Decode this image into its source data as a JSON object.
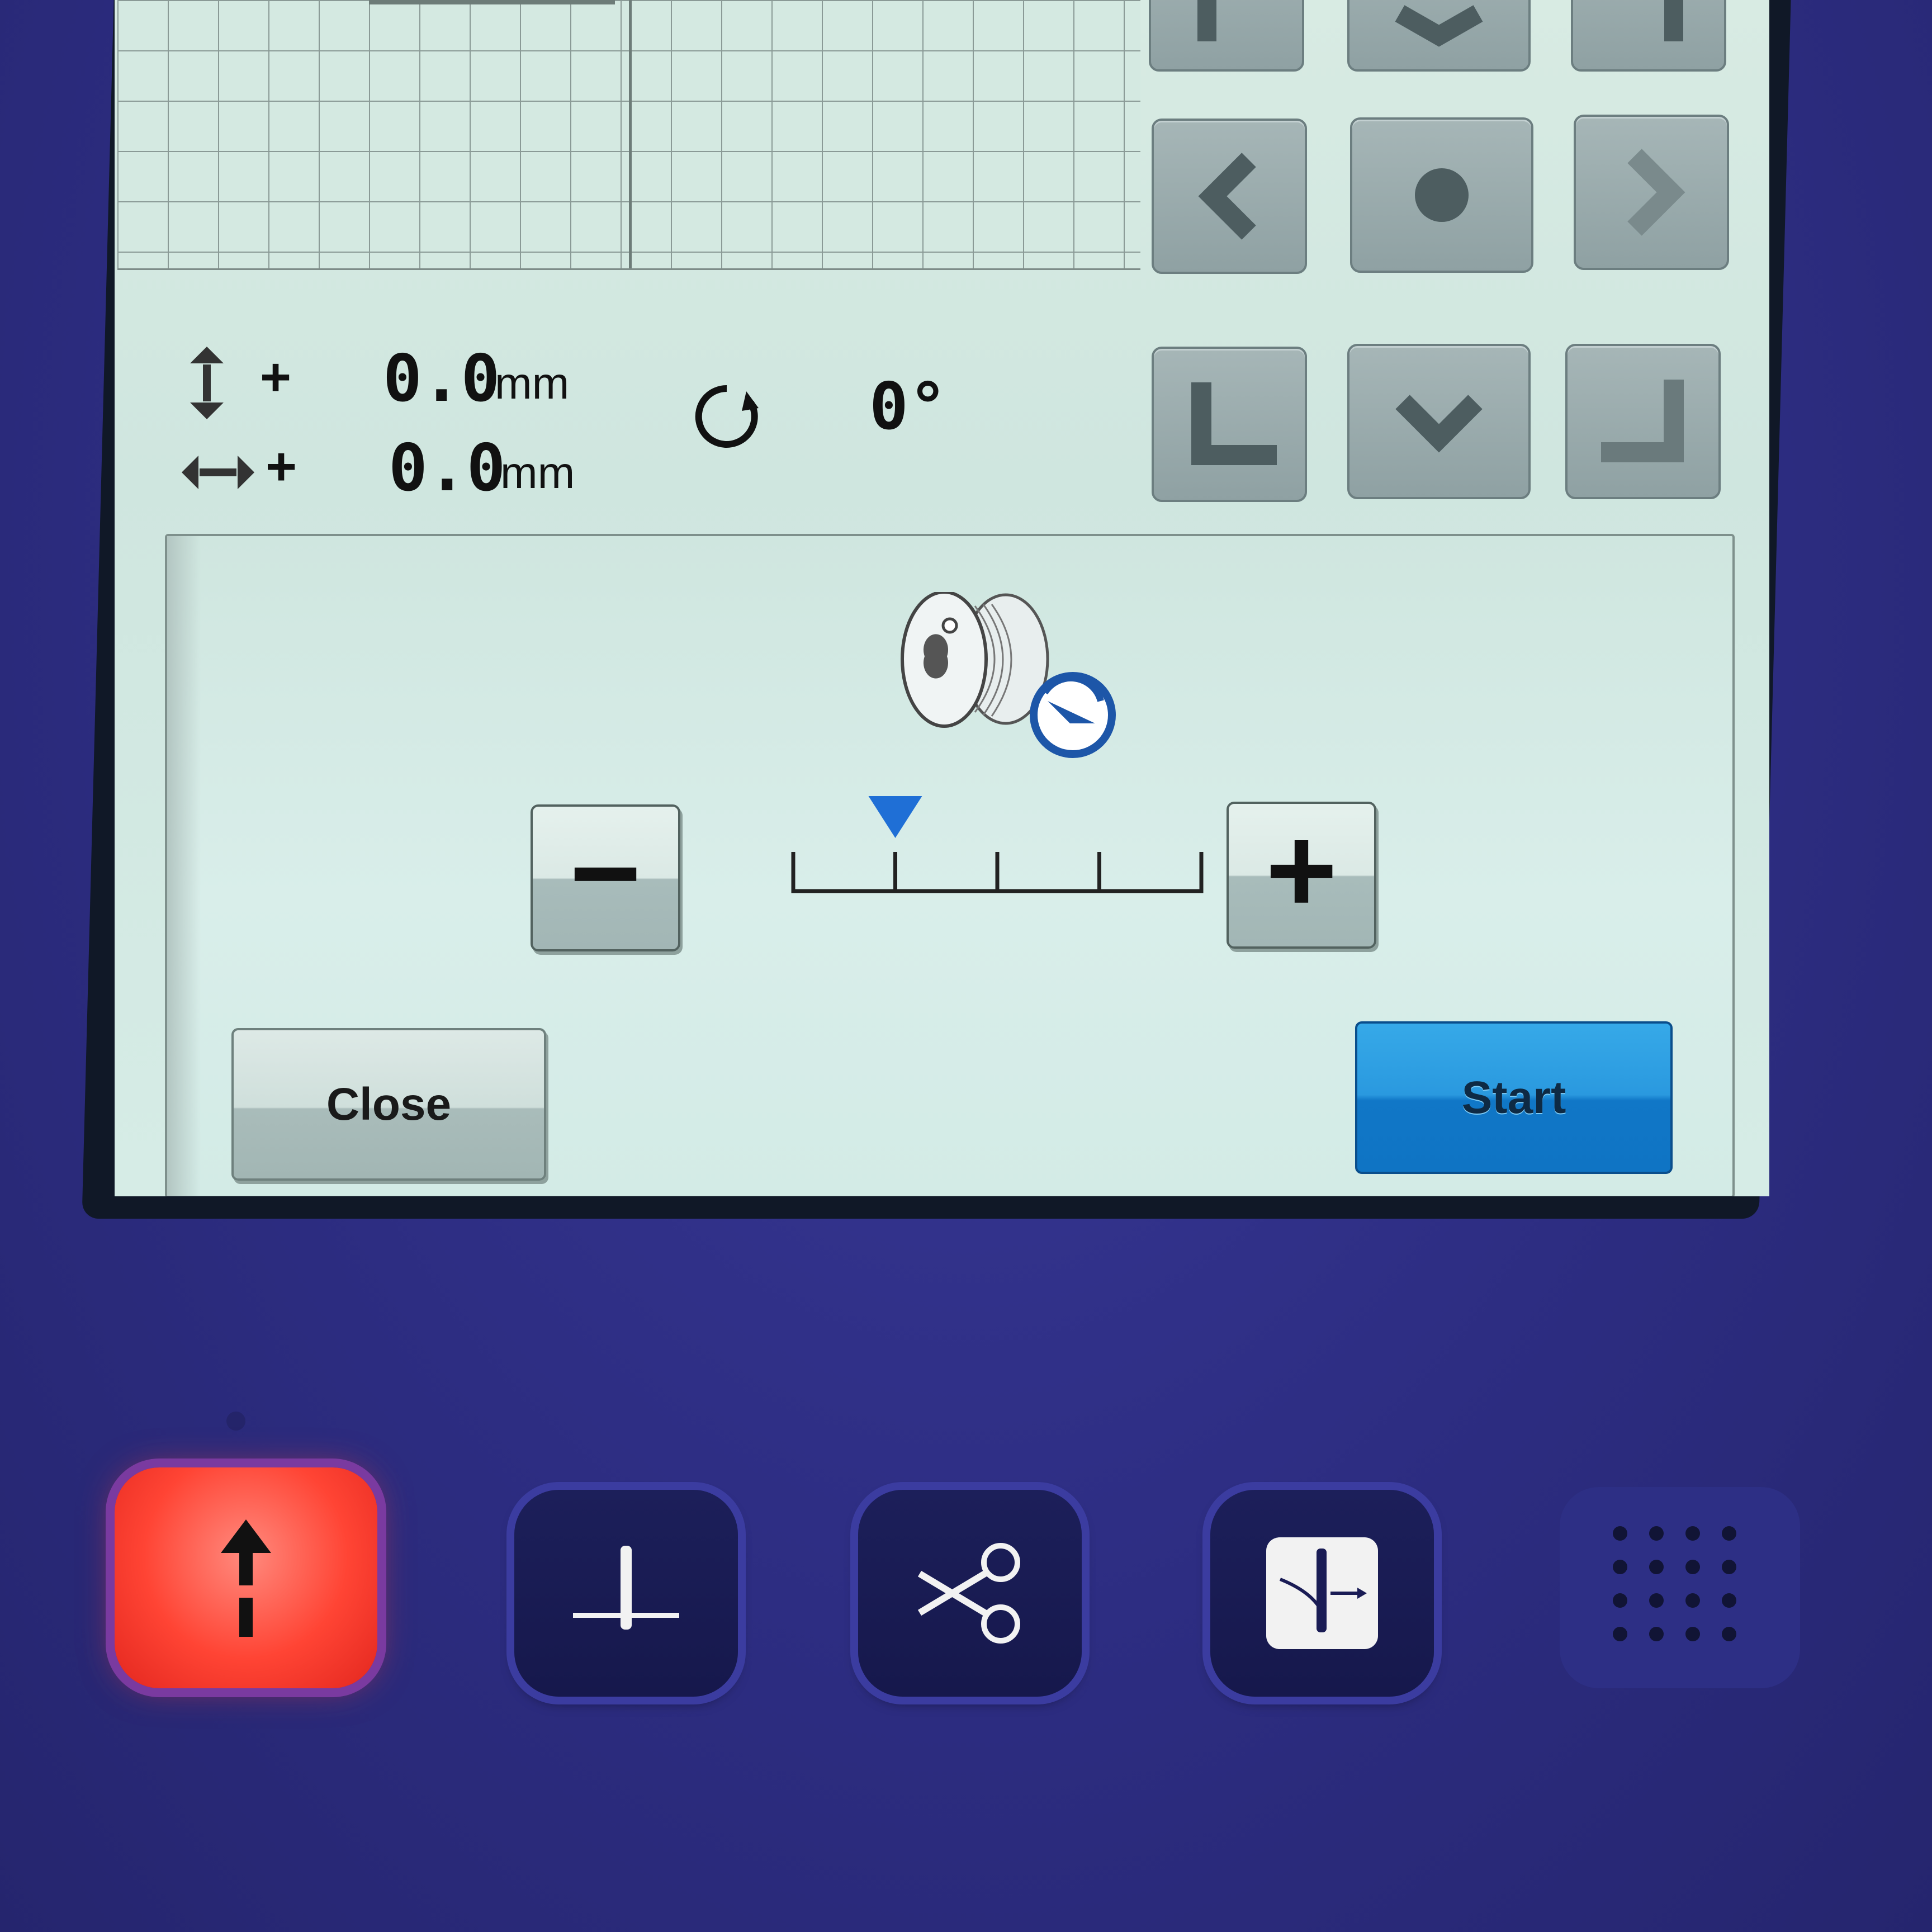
{
  "screen": {
    "offset_vertical": {
      "sign": "+",
      "value": "0.0",
      "unit": "mm",
      "icon": "vertical-move-icon"
    },
    "offset_horizontal": {
      "sign": "+",
      "value": "0.0",
      "unit": "mm",
      "icon": "horizontal-move-icon"
    },
    "rotation": {
      "value": "0°",
      "icon": "rotate-icon"
    },
    "nav_buttons": [
      "up-left-corner",
      "up",
      "up-right-corner",
      "left",
      "center",
      "right",
      "down-left-corner",
      "down",
      "down-right-corner"
    ]
  },
  "dialog": {
    "icon": "bobbin-winding-icon",
    "speed_level": 1,
    "speed_level_max": 4,
    "minus_label": "−",
    "plus_label": "+",
    "close_label": "Close",
    "start_label": "Start",
    "colors": {
      "start": "#2a99df",
      "indicator": "#1f6fd6"
    }
  },
  "hardware_buttons": [
    {
      "name": "start-stop-button",
      "icon": "arrow-up-icon",
      "lit": true,
      "color": "#ff4434"
    },
    {
      "name": "needle-position-button",
      "icon": "needle-position-icon"
    },
    {
      "name": "thread-cutter-button",
      "icon": "scissors-icon"
    },
    {
      "name": "needle-threading-button",
      "icon": "needle-threading-icon"
    }
  ]
}
